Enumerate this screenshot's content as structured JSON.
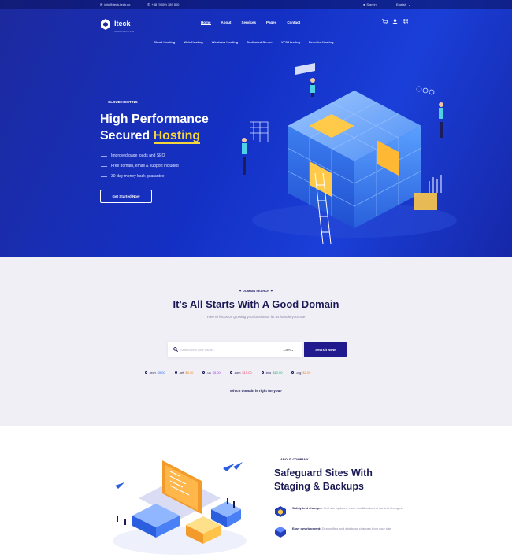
{
  "topbar": {
    "email": "info@iteck-tech.co",
    "phone": "+88 (0000) 789 500",
    "signin": "Sign in",
    "language": "English"
  },
  "brand": {
    "name": "Iteck",
    "tagline": "CLOUD HOSTING"
  },
  "menu": [
    {
      "label": "Home"
    },
    {
      "label": "About"
    },
    {
      "label": "Services"
    },
    {
      "label": "Pages"
    },
    {
      "label": "Contact"
    }
  ],
  "subnav": [
    {
      "label": "Cloud Hosting"
    },
    {
      "label": "Web Hosting"
    },
    {
      "label": "Windows Hosting"
    },
    {
      "label": "Dedicated Server"
    },
    {
      "label": "VPS Hosting"
    },
    {
      "label": "Reseller Hosting"
    }
  ],
  "hero": {
    "eyebrow": "CLOUD HOSTING",
    "title_line1": "High Performance",
    "title_word": "Secured ",
    "title_highlight": "Hosting",
    "features": [
      "Improved page loads and SEO",
      "Free domain, email & support included",
      "30-day money back guarantee"
    ],
    "cta": "Get Started Now"
  },
  "domain": {
    "eyebrow": "DOMAIN SEARCH",
    "title": "It's All Starts With A Good Domain",
    "subtitle": "Free to focus on growing your business, let us handle your site",
    "placeholder": "Search with your name...",
    "select": ".Com",
    "button": "Search Now",
    "tlds": [
      {
        "ext": ".tech",
        "price": "$9.00",
        "color": "#2d6cf6"
      },
      {
        "ext": ".net",
        "price": "$6.00",
        "color": "#f08a24"
      },
      {
        "ext": ".us",
        "price": "$5.00",
        "color": "#a23cf0"
      },
      {
        "ext": ".com",
        "price": "$15.00",
        "color": "#ef3b5d"
      },
      {
        "ext": ".info",
        "price": "$10.00",
        "color": "#19b06f"
      },
      {
        "ext": ".org",
        "price": "$2.00",
        "color": "#f08a24"
      }
    ],
    "question": "Which domain is right for you?"
  },
  "about": {
    "eyebrow": "ABOUT COMPANY",
    "title_line1": "Safeguard Sites With",
    "title_line2": "Staging & Backups",
    "features": [
      {
        "title": "Safely test changes:",
        "text": "Test site updates, code modifications & content changes."
      },
      {
        "title": "Easy development:",
        "text": "Deploy files and database changes from your site."
      }
    ]
  },
  "colors": {
    "hero": "#1430c4",
    "accent": "#f4d53c",
    "dark": "#201a8e"
  }
}
